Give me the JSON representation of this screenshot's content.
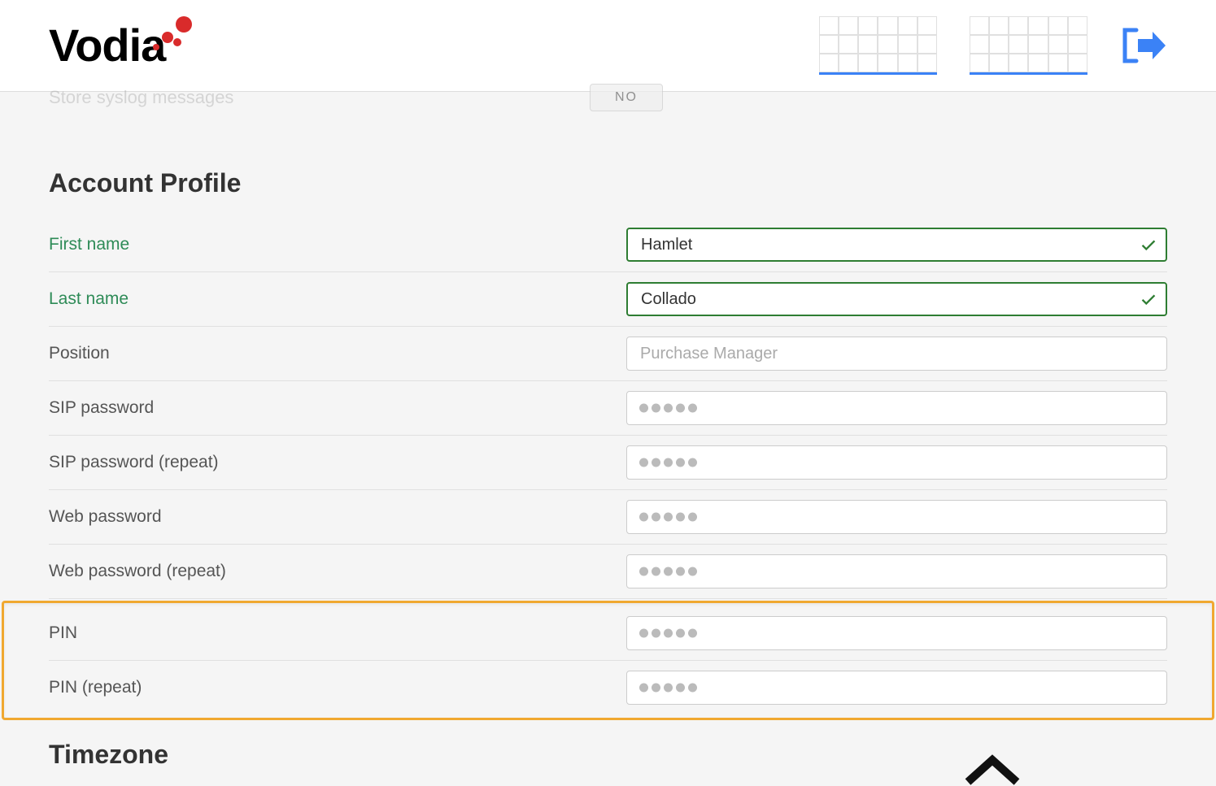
{
  "header": {
    "logo_text": "Vodia",
    "partial_row_label": "Store syslog messages",
    "partial_toggle_value": "NO"
  },
  "sections": {
    "account_profile_title": "Account Profile",
    "timezone_title": "Timezone"
  },
  "fields": {
    "first_name": {
      "label": "First name",
      "value": "Hamlet"
    },
    "last_name": {
      "label": "Last name",
      "value": "Collado"
    },
    "position": {
      "label": "Position",
      "placeholder": "Purchase Manager",
      "value": ""
    },
    "sip_password": {
      "label": "SIP password"
    },
    "sip_password_repeat": {
      "label": "SIP password (repeat)"
    },
    "web_password": {
      "label": "Web password"
    },
    "web_password_repeat": {
      "label": "Web password (repeat)"
    },
    "pin": {
      "label": "PIN"
    },
    "pin_repeat": {
      "label": "PIN (repeat)"
    }
  }
}
